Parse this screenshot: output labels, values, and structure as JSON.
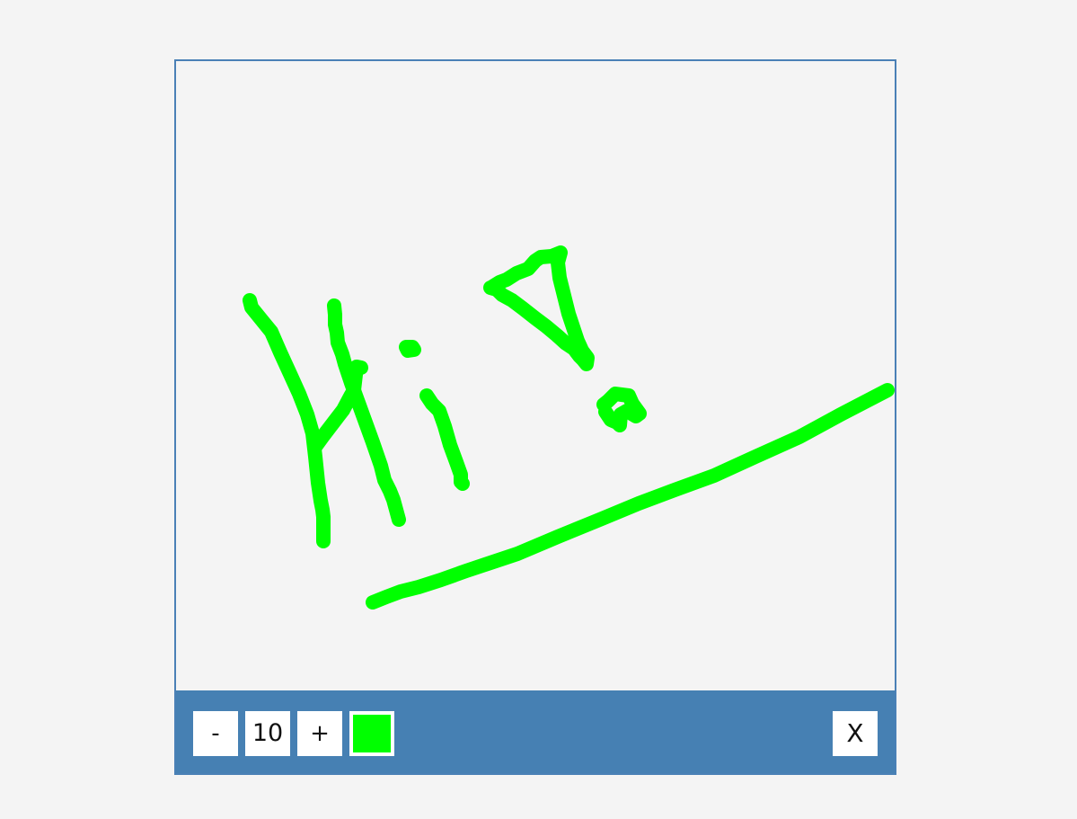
{
  "toolbar": {
    "decrease_label": "-",
    "brush_size": "10",
    "increase_label": "+",
    "selected_color": "#00ff00",
    "close_label": "X"
  },
  "canvas": {
    "background": "#f4f4f4",
    "stroke_color": "#00ff00"
  },
  "colors": {
    "frame_border": "#4a80b6",
    "toolbar_bg": "#4680b3"
  }
}
